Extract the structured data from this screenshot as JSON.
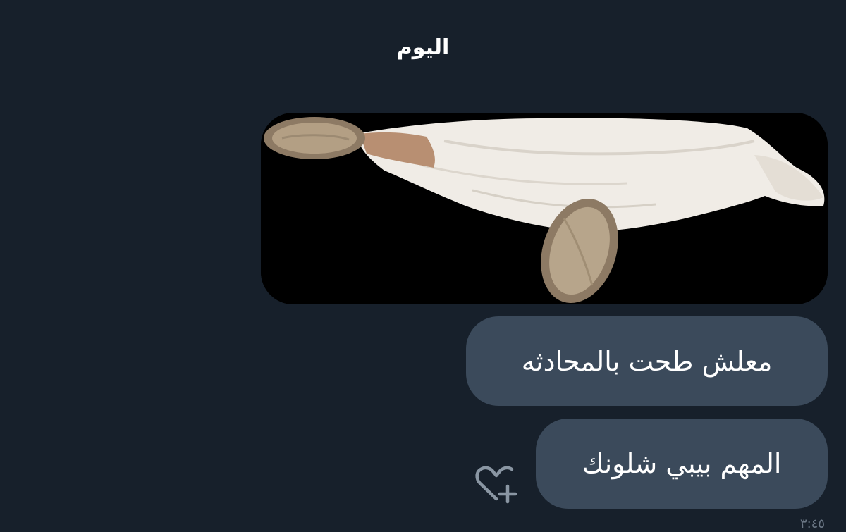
{
  "chat": {
    "day_divider": "اليوم",
    "messages": [
      {
        "type": "image",
        "icon": "meme-photo-icon"
      },
      {
        "type": "text",
        "text": "معلش طحت بالمحادثه"
      },
      {
        "type": "text",
        "text": "المهم بيبي شلونك"
      }
    ],
    "reaction_icon": "heart-plus-icon",
    "timestamp": "٣:٤٥"
  },
  "colors": {
    "background": "#17202b",
    "bubble": "#3b4a5b",
    "text": "#ffffff",
    "muted": "#6b7785"
  }
}
